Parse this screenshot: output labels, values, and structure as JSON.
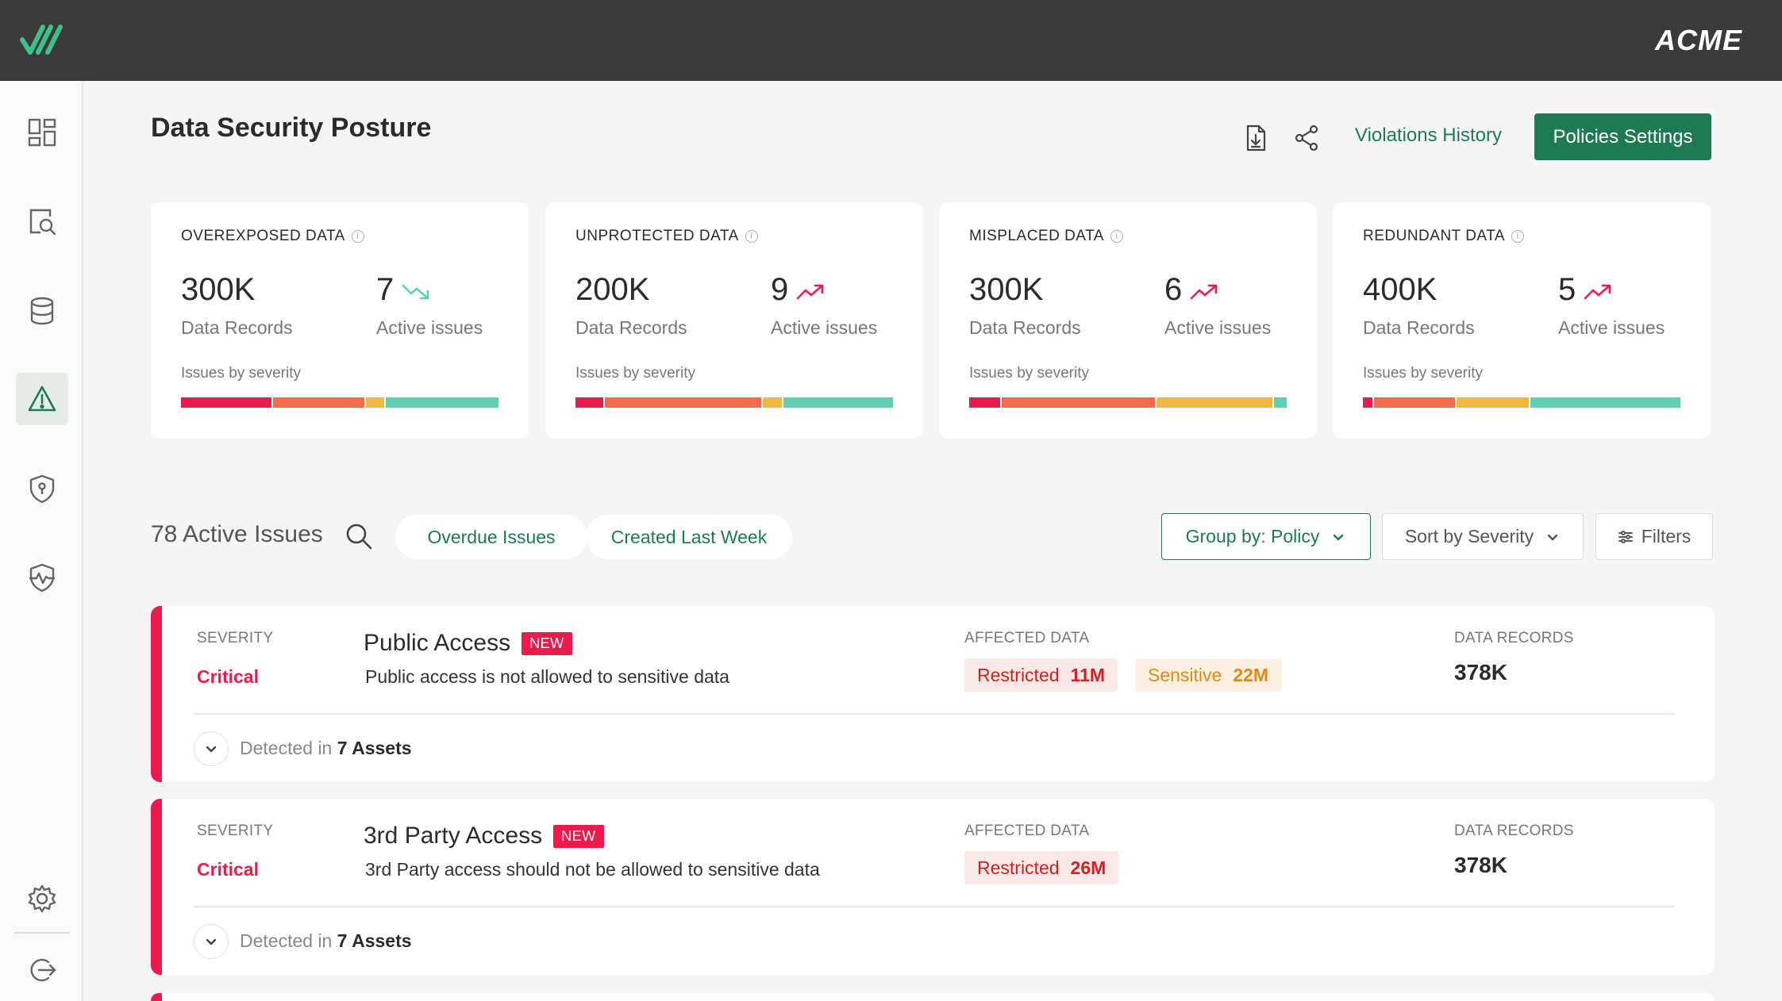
{
  "brand": "ACME",
  "colors": {
    "accent": "#1e7a52",
    "critical": "#ee1a4b",
    "high": "#f26b4b",
    "medium": "#eeb93f",
    "low": "#61cfb0"
  },
  "nav": [
    {
      "icon": "dashboard-icon",
      "active": false
    },
    {
      "icon": "document-search-icon",
      "active": false
    },
    {
      "icon": "database-icon",
      "active": false
    },
    {
      "icon": "warning-icon",
      "active": true
    },
    {
      "icon": "shield-icon",
      "active": false
    },
    {
      "icon": "shield-pulse-icon",
      "active": false
    },
    {
      "icon": "gear-icon",
      "active": false
    },
    {
      "icon": "logout-icon",
      "active": false
    }
  ],
  "header": {
    "title": "Data Security Posture",
    "violations_label": "Violations History",
    "policies_label": "Policies Settings"
  },
  "cards": [
    {
      "title": "OVEREXPOSED DATA",
      "records": "300K",
      "records_label": "Data Records",
      "issues": "7",
      "issues_label": "Active issues",
      "trend": "down",
      "severity_label": "Issues by severity",
      "severity": [
        0.29,
        0.29,
        0.06,
        0.36
      ]
    },
    {
      "title": "UNPROTECTED DATA",
      "records": "200K",
      "records_label": "Data Records",
      "issues": "9",
      "issues_label": "Active issues",
      "trend": "up",
      "severity_label": "Issues by severity",
      "severity": [
        0.09,
        0.5,
        0.06,
        0.35
      ]
    },
    {
      "title": "MISPLACED DATA",
      "records": "300K",
      "records_label": "Data Records",
      "issues": "6",
      "issues_label": "Active issues",
      "trend": "up",
      "severity_label": "Issues by severity",
      "severity": [
        0.1,
        0.49,
        0.37,
        0.04
      ]
    },
    {
      "title": "REDUNDANT DATA",
      "records": "400K",
      "records_label": "Data Records",
      "issues": "5",
      "issues_label": "Active issues",
      "trend": "up",
      "severity_label": "Issues by severity",
      "severity": [
        0.03,
        0.26,
        0.23,
        0.48
      ]
    }
  ],
  "issues_bar": {
    "count_label": "78 Active Issues",
    "overdue_label": "Overdue Issues",
    "created_label": "Created Last Week",
    "group_prefix": "Group by:",
    "group_value": "Policy",
    "sort_label": "Sort by Severity",
    "filters_label": "Filters"
  },
  "issues": [
    {
      "severity_label": "SEVERITY",
      "severity": "Critical",
      "title": "Public Access",
      "badge": "NEW",
      "description": "Public access is not allowed to sensitive data",
      "affected_label": "AFFECTED DATA",
      "tags": [
        {
          "type": "restricted",
          "label": "Restricted",
          "value": "11M"
        },
        {
          "type": "sensitive",
          "label": "Sensitive",
          "value": "22M"
        }
      ],
      "records_label": "DATA RECORDS",
      "records": "378K",
      "detected_prefix": "Detected in",
      "detected_value": "7 Assets"
    },
    {
      "severity_label": "SEVERITY",
      "severity": "Critical",
      "title": "3rd Party Access",
      "badge": "NEW",
      "description": "3rd Party access should not be allowed to sensitive data",
      "affected_label": "AFFECTED DATA",
      "tags": [
        {
          "type": "restricted",
          "label": "Restricted",
          "value": "26M"
        }
      ],
      "records_label": "DATA RECORDS",
      "records": "378K",
      "detected_prefix": "Detected in",
      "detected_value": "7 Assets"
    }
  ]
}
